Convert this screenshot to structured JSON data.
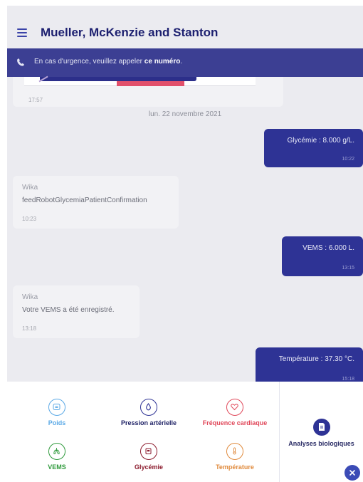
{
  "header": {
    "title": "Mueller, McKenzie and Stanton"
  },
  "emergency": {
    "prefix": "En cas d'urgence, veuillez appeler",
    "link": "ce numéro",
    "suffix": "."
  },
  "chat": {
    "previous_message": {
      "time": "17:57"
    },
    "date_separator": "lun. 22 novembre 2021",
    "messages": [
      {
        "direction": "out",
        "text": "Glycémie : 8.000 g/L.",
        "time": "10:22"
      },
      {
        "direction": "in",
        "sender": "Wika",
        "text": "feedRobotGlycemiaPatientConfirmation",
        "time": "10:23"
      },
      {
        "direction": "out",
        "text": "VEMS : 6.000 L.",
        "time": "13:15"
      },
      {
        "direction": "in",
        "sender": "Wika",
        "text": "Votre VEMS a été enregistré.",
        "time": "13:18"
      },
      {
        "direction": "out",
        "text": "Température : 37.30 °C.",
        "time": "15:18"
      }
    ]
  },
  "measures": [
    {
      "label": "Poids",
      "icon": "weight-icon",
      "color": "#5aa9e6"
    },
    {
      "label": "Pression artérielle",
      "icon": "drop-icon",
      "color": "#2e3395"
    },
    {
      "label": "Fréquence cardiaque",
      "icon": "heart-icon",
      "color": "#e0485a"
    },
    {
      "label": "VEMS",
      "icon": "lungs-icon",
      "color": "#2f9a3c"
    },
    {
      "label": "Glycémie",
      "icon": "glucose-icon",
      "color": "#8b1a2c"
    },
    {
      "label": "Température",
      "icon": "thermometer-icon",
      "color": "#e08a3c"
    }
  ],
  "analyses": {
    "label": "Analyses biologiques",
    "icon": "document-icon",
    "color": "#2e3395"
  },
  "close_button": {
    "icon": "close-icon"
  }
}
